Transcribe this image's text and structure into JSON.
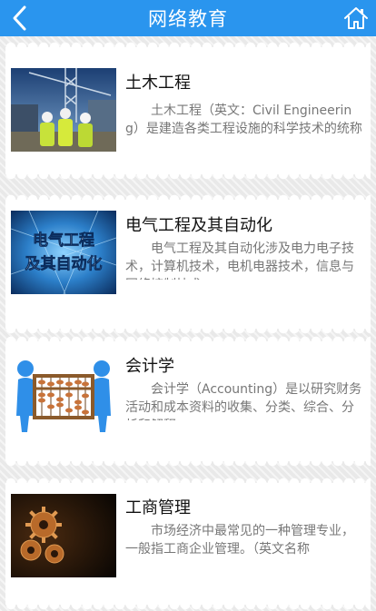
{
  "header": {
    "title": "网络教育",
    "back_icon": "chevron-left-icon",
    "home_icon": "home-icon",
    "bar_color": "#2a95ee"
  },
  "courses": [
    {
      "title": "土木工程",
      "description": "土木工程（英文：Civil Engineering）是建造各类工程设施的科学技术的统称",
      "image": "construction-workers-photo"
    },
    {
      "title": "电气工程及其自动化",
      "description": "电气工程及其自动化涉及电力电子技术，计算机技术，电机电器技术，信息与网络控制技术",
      "image_text": "电气工程及其自动化",
      "image_line1": "电气工程",
      "image_line2": "及其自动化"
    },
    {
      "title": "会计学",
      "description": "会计学（Accounting）是以研究财务活动和成本资料的收集、分类、综合、分析和解释",
      "image": "figures-holding-abacus-illustration"
    },
    {
      "title": "工商管理",
      "description": "市场经济中最常见的一种管理专业，一般指工商企业管理。（英文名称",
      "image": "gears-dark-photo"
    }
  ]
}
